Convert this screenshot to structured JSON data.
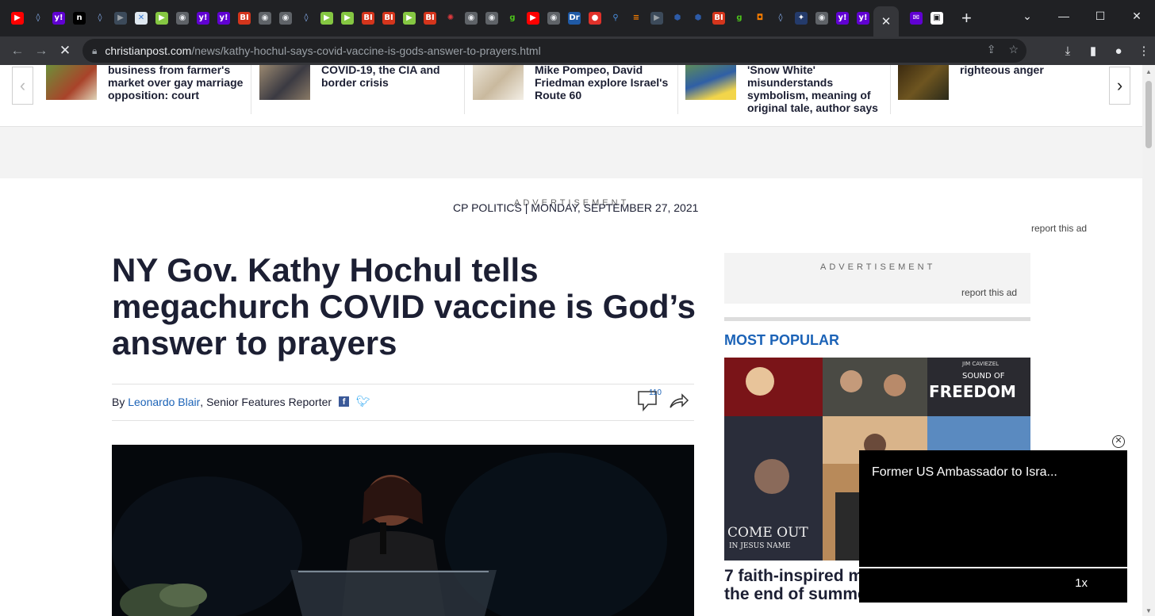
{
  "browser": {
    "tab_favicons": [
      {
        "name": "youtube-icon",
        "glyph": "▶",
        "bg": "#ff0000",
        "fg": "#fff"
      },
      {
        "name": "shield-icon",
        "glyph": "◊",
        "bg": "#202124",
        "fg": "#8ab4f8"
      },
      {
        "name": "yahoo-icon",
        "glyph": "y!",
        "bg": "#6001d2",
        "fg": "#fff"
      },
      {
        "name": "n-icon",
        "glyph": "n",
        "bg": "#000",
        "fg": "#fff"
      },
      {
        "name": "shield-icon",
        "glyph": "◊",
        "bg": "#202124",
        "fg": "#8ab4f8"
      },
      {
        "name": "tag-icon",
        "glyph": "▶",
        "bg": "#3c4a5a",
        "fg": "#9aa0a6"
      },
      {
        "name": "map-icon",
        "glyph": "✕",
        "bg": "#dfe8f0",
        "fg": "#3b7dd8"
      },
      {
        "name": "rumble-icon",
        "glyph": "▶",
        "bg": "#85c742",
        "fg": "#fff"
      },
      {
        "name": "globe-icon",
        "glyph": "◉",
        "bg": "#5f6368",
        "fg": "#e8eaed"
      },
      {
        "name": "yahoo-icon",
        "glyph": "y!",
        "bg": "#6001d2",
        "fg": "#fff"
      },
      {
        "name": "yahoo-icon",
        "glyph": "y!",
        "bg": "#6001d2",
        "fg": "#fff"
      },
      {
        "name": "business-insider-icon",
        "glyph": "BI",
        "bg": "#d4351c",
        "fg": "#fff"
      },
      {
        "name": "globe-icon",
        "glyph": "◉",
        "bg": "#5f6368",
        "fg": "#e8eaed"
      },
      {
        "name": "globe-icon",
        "glyph": "◉",
        "bg": "#5f6368",
        "fg": "#e8eaed"
      },
      {
        "name": "shield-icon",
        "glyph": "◊",
        "bg": "#202124",
        "fg": "#8ab4f8"
      },
      {
        "name": "rumble-icon",
        "glyph": "▶",
        "bg": "#85c742",
        "fg": "#fff"
      },
      {
        "name": "rumble-icon",
        "glyph": "▶",
        "bg": "#85c742",
        "fg": "#fff"
      },
      {
        "name": "business-insider-icon",
        "glyph": "BI",
        "bg": "#d4351c",
        "fg": "#fff"
      },
      {
        "name": "business-insider-icon",
        "glyph": "BI",
        "bg": "#d4351c",
        "fg": "#fff"
      },
      {
        "name": "rumble-icon",
        "glyph": "▶",
        "bg": "#85c742",
        "fg": "#fff"
      },
      {
        "name": "business-insider-icon",
        "glyph": "BI",
        "bg": "#d4351c",
        "fg": "#fff"
      },
      {
        "name": "starburst-icon",
        "glyph": "✺",
        "bg": "#202124",
        "fg": "#e03a3e"
      },
      {
        "name": "globe-icon",
        "glyph": "◉",
        "bg": "#5f6368",
        "fg": "#e8eaed"
      },
      {
        "name": "globe-icon",
        "glyph": "◉",
        "bg": "#5f6368",
        "fg": "#e8eaed"
      },
      {
        "name": "g-icon",
        "glyph": "g",
        "bg": "#202124",
        "fg": "#4cc31b"
      },
      {
        "name": "youtube-icon",
        "glyph": "▶",
        "bg": "#ff0000",
        "fg": "#fff"
      },
      {
        "name": "globe-icon",
        "glyph": "◉",
        "bg": "#5f6368",
        "fg": "#e8eaed"
      },
      {
        "name": "dr-icon",
        "glyph": "Dr",
        "bg": "#1f5aa6",
        "fg": "#fff"
      },
      {
        "name": "microphone-icon",
        "glyph": "●",
        "bg": "#e0312a",
        "fg": "#fff"
      },
      {
        "name": "search-icon",
        "glyph": "⚲",
        "bg": "#202124",
        "fg": "#4a90e2"
      },
      {
        "name": "bars-icon",
        "glyph": "≡",
        "bg": "#202124",
        "fg": "#f57c00"
      },
      {
        "name": "tag-icon",
        "glyph": "▶",
        "bg": "#3c4a5a",
        "fg": "#9aa0a6"
      },
      {
        "name": "cube-icon",
        "glyph": "⬢",
        "bg": "#202124",
        "fg": "#2d5ba8"
      },
      {
        "name": "cube-icon",
        "glyph": "⬢",
        "bg": "#202124",
        "fg": "#2d5ba8"
      },
      {
        "name": "business-insider-icon",
        "glyph": "BI",
        "bg": "#d4351c",
        "fg": "#fff"
      },
      {
        "name": "g-icon",
        "glyph": "g",
        "bg": "#202124",
        "fg": "#4cc31b"
      },
      {
        "name": "badge-icon",
        "glyph": "◘",
        "bg": "#202124",
        "fg": "#f57c00"
      },
      {
        "name": "shield-icon",
        "glyph": "◊",
        "bg": "#202124",
        "fg": "#8ab4f8"
      },
      {
        "name": "crest-icon",
        "glyph": "✦",
        "bg": "#243b6b",
        "fg": "#fff"
      },
      {
        "name": "globe-icon",
        "glyph": "◉",
        "bg": "#5f6368",
        "fg": "#e8eaed"
      },
      {
        "name": "yahoo-icon",
        "glyph": "y!",
        "bg": "#6001d2",
        "fg": "#fff"
      },
      {
        "name": "yahoo-icon",
        "glyph": "y!",
        "bg": "#6001d2",
        "fg": "#fff"
      }
    ],
    "after_active": [
      {
        "name": "yahoo-mail-icon",
        "glyph": "✉",
        "bg": "#6001d2",
        "fg": "#fff"
      },
      {
        "name": "book-icon",
        "glyph": "▣",
        "bg": "#ffffff",
        "fg": "#202124"
      }
    ],
    "active_tab_close": "✕",
    "new_tab": "+",
    "url_domain": "christianpost.com",
    "url_path": "/news/kathy-hochul-says-covid-vaccine-is-gods-answer-to-prayers.html"
  },
  "carousel": {
    "items": [
      {
        "title": "business from farmer's\nmarket over gay marriage\nopposition: court",
        "thumb": "#8a5a3a"
      },
      {
        "title": "COVID-19, the CIA and\nborder crisis",
        "thumb": "#7a6a58"
      },
      {
        "title": "Mike Pompeo, David\nFriedman explore Israel's\nRoute 60",
        "thumb": "#d9cdb8"
      },
      {
        "title": "'Snow White'\nmisunderstands\nsymbolism, meaning of\noriginal tale, author says",
        "thumb": "#3f6d9a"
      },
      {
        "title": "righteous anger",
        "thumb": "#4a3a1a"
      }
    ]
  },
  "ads": {
    "label": "ADVERTISEMENT",
    "report": "report this ad"
  },
  "article": {
    "kicker": "CP POLITICS | MONDAY, SEPTEMBER 27, 2021",
    "headline": "NY Gov. Kathy Hochul tells megachurch COVID vaccine is God’s answer to prayers",
    "by": "By ",
    "author": "Leonardo Blair",
    "role": ", Senior Features Reporter",
    "comment_count": "110"
  },
  "sidebar": {
    "most_popular": "MOST POPULAR",
    "popular_caption_line1": "7 faith-inspired m",
    "popular_caption_line2": "the end of summe",
    "poster_text_1": "SOUND OF",
    "poster_text_2": "FREEDOM",
    "poster_text_3": "COME OUT",
    "poster_text_4": "IN JESUS NAME",
    "poster_actor": "JIM CAVIEZEL"
  },
  "video_popup": {
    "title": "Former US Ambassador to Isra...",
    "speed": "1x",
    "close": "✕"
  }
}
